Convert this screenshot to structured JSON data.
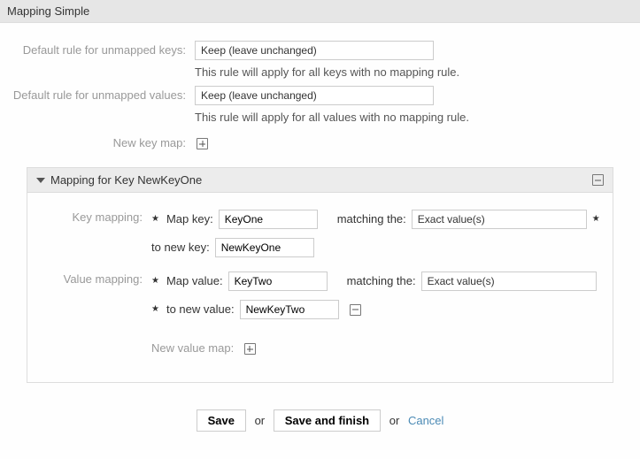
{
  "header": {
    "title": "Mapping Simple"
  },
  "defaults": {
    "unmappedKeysLabel": "Default rule for unmapped keys:",
    "unmappedKeysValue": "Keep (leave unchanged)",
    "unmappedKeysHelp": "This rule will apply for all keys with no mapping rule.",
    "unmappedValuesLabel": "Default rule for unmapped values:",
    "unmappedValuesValue": "Keep (leave unchanged)",
    "unmappedValuesHelp": "This rule will apply for all values with no mapping rule.",
    "newKeyMapLabel": "New key map:"
  },
  "panel": {
    "title": "Mapping for Key NewKeyOne",
    "keyMapping": {
      "label": "Key mapping:",
      "mapKeyText": "Map key:",
      "mapKeyInput": "KeyOne",
      "matchingText": "matching the:",
      "matchingSelect": "Exact value(s)",
      "toNewKeyText": "to new key:",
      "newKeyInput": "NewKeyOne"
    },
    "valueMapping": {
      "label": "Value mapping:",
      "mapValueText": "Map value:",
      "mapValueInput": "KeyTwo",
      "matchingText": "matching the:",
      "matchingSelect": "Exact value(s)",
      "toNewValueText": "to new value:",
      "newValueInput": "NewKeyTwo",
      "newValueMapLabel": "New value map:"
    }
  },
  "buttons": {
    "save": "Save",
    "or1": "or",
    "saveFinish": "Save and finish",
    "or2": "or",
    "cancel": "Cancel"
  }
}
